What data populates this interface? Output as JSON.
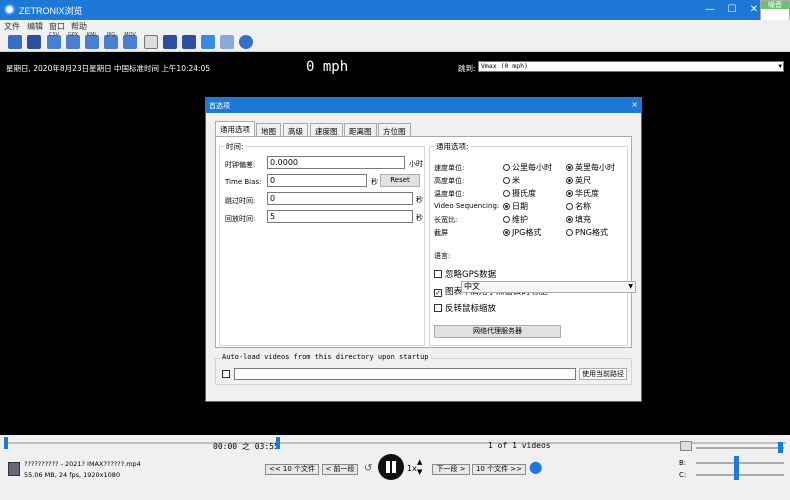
{
  "window": {
    "title": "ZETRONIX浏览",
    "popup_label": "噪音"
  },
  "menu": [
    "文件",
    "编辑",
    "窗口",
    "帮助"
  ],
  "toolbar": {
    "labels": [
      "CSV",
      "GPX",
      "KML",
      "JPG",
      "MOV"
    ]
  },
  "info": {
    "date": "星期日, 2020年8月23日星期日  中国标准时间 上午10:24:05",
    "speed": "0 mph",
    "jump_label": "跳到:",
    "jump_value": "Vmax (0 mph)"
  },
  "dialog": {
    "title": "首选项",
    "close": "×",
    "tabs": [
      "通用选项",
      "地图",
      "高级",
      "速度图",
      "距离图",
      "方位图"
    ],
    "time_group": {
      "title": "时间:",
      "clock_offset_label": "时钟偏差:",
      "clock_offset_value": "0.0000",
      "clock_offset_unit": "小时",
      "time_bias_label": "Time Bias:",
      "time_bias_value": "0",
      "time_bias_unit": "秒",
      "reset_label": "Reset",
      "skip_label": "跳过时间:",
      "skip_value": "0",
      "skip_unit": "秒",
      "rewind_label": "回放时间:",
      "rewind_value": "5",
      "rewind_unit": "秒"
    },
    "general_group": {
      "title": "通用选项:",
      "rows": [
        {
          "label": "速度单位:",
          "a": "公里每小时",
          "b": "英里每小时",
          "selected": "b"
        },
        {
          "label": "高度单位:",
          "a": "米",
          "b": "英尺",
          "selected": "b"
        },
        {
          "label": "温度单位:",
          "a": "摄氏度",
          "b": "华氏度",
          "selected": "b"
        },
        {
          "label": "Video Sequencing:",
          "a": "日期",
          "b": "名称",
          "selected": "a"
        },
        {
          "label": "长宽比:",
          "a": "维护",
          "b": "填充",
          "selected": "b"
        },
        {
          "label": "截屏",
          "a": "JPG格式",
          "b": "PNG格式",
          "selected": "a"
        }
      ],
      "language_label": "语言:",
      "language_value": "中文",
      "checks": [
        {
          "label": "忽略GPS数据",
          "checked": false
        },
        {
          "label": "图表中启用了点击去的功能",
          "checked": true
        },
        {
          "label": "反转鼠标缩放",
          "checked": false
        }
      ],
      "proxy_button": "网络代理服务器"
    },
    "autoload": {
      "title": "Auto-load videos from this directory upon startup",
      "path": "",
      "use_current": "使用当前路径"
    }
  },
  "player": {
    "time": "00:00 之 03:55",
    "video_count": "1 of 1 videos",
    "file_name": "?????????? - 2021? IMAX??????.mp4",
    "file_info": "55.06 MB, 24 fps, 1920x1080",
    "prev10": "<< 10 个文件",
    "prev": "< 前一段",
    "next": "下一段 >",
    "next10": "10 个文件 >>",
    "rate": "1x",
    "b_label": "B:",
    "c_label": "C:",
    "progress_fraction": 0.0
  }
}
